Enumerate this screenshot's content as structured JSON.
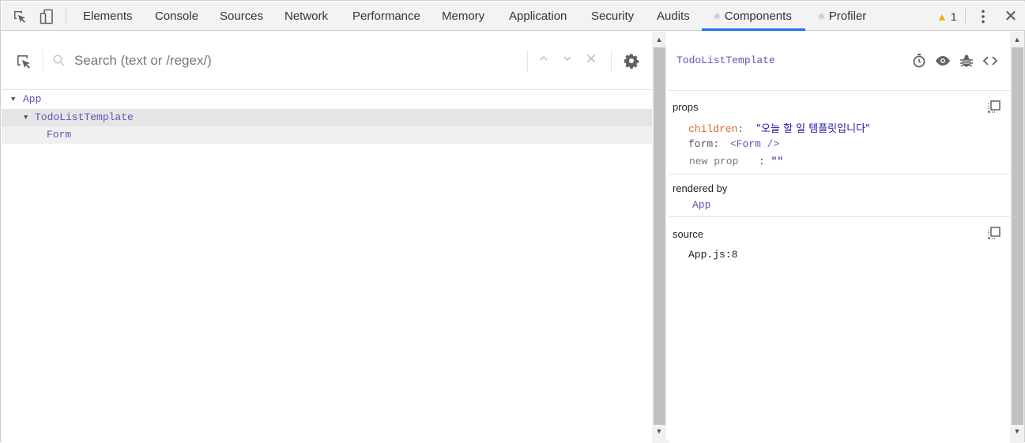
{
  "toolbar": {
    "tabs": [
      {
        "label": "Elements"
      },
      {
        "label": "Console"
      },
      {
        "label": "Sources"
      },
      {
        "label": "Network"
      },
      {
        "label": "Performance"
      },
      {
        "label": "Memory"
      },
      {
        "label": "Application"
      },
      {
        "label": "Security"
      },
      {
        "label": "Audits"
      },
      {
        "label": "Components",
        "active": true
      },
      {
        "label": "Profiler"
      }
    ],
    "warning_count": "1",
    "accent_color": "#1a73e8"
  },
  "search": {
    "placeholder": "Search (text or /regex/)"
  },
  "tree": {
    "nodes": [
      {
        "label": "App"
      },
      {
        "label": "TodoListTemplate"
      },
      {
        "label": "Form"
      }
    ]
  },
  "inspector": {
    "component_name": "TodoListTemplate",
    "props_title": "props",
    "props": [
      {
        "key": "children",
        "sep": ":",
        "value": "\"오늘 할 일 템플릿입니다\""
      },
      {
        "key": "form",
        "sep": ":",
        "value": "<Form />"
      },
      {
        "key": "new prop",
        "sep": ":",
        "value": "\"\""
      }
    ],
    "rendered_by_title": "rendered by",
    "rendered_by": "App",
    "source_title": "source",
    "source": "App.js:8"
  }
}
